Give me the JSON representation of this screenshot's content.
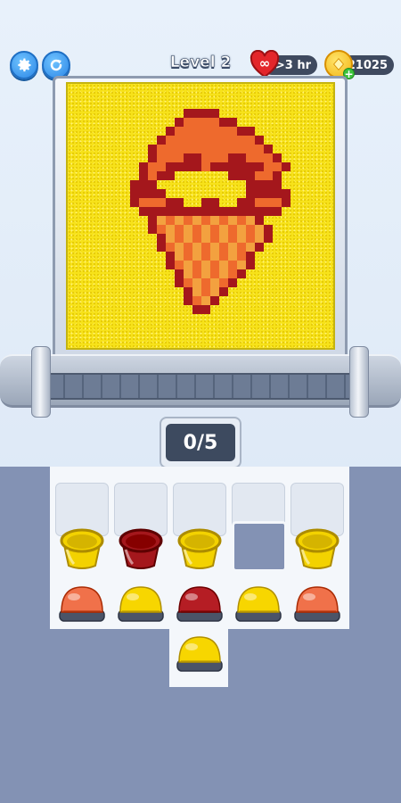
{
  "hud": {
    "level_label": "Level 2",
    "lives_text": "∞",
    "lives_timer": ">3 hr",
    "coins": "21025",
    "coin_plus": "+",
    "settings_icon": "gear-icon",
    "restart_icon": "restart-icon"
  },
  "progress": {
    "label": "0/5",
    "done": 0,
    "total": 5
  },
  "picture": {
    "subject": "ice-cream-cone",
    "colors": {
      "background": "#f7e21a",
      "orange": "#ee6a2d",
      "dark_red": "#a4171c",
      "light": "#f3a13f"
    }
  },
  "pieces": {
    "top_row": [
      {
        "kind": "cup",
        "color": "#f3d200"
      },
      {
        "kind": "cup",
        "color": "#a4171c"
      },
      {
        "kind": "cup",
        "color": "#f3d200"
      },
      {
        "kind": "empty",
        "color": ""
      },
      {
        "kind": "cup",
        "color": "#f3d200"
      }
    ],
    "bottom_row": [
      {
        "kind": "dome",
        "color": "#f0714a"
      },
      {
        "kind": "dome",
        "color": "#f7d600"
      },
      {
        "kind": "dome",
        "color": "#b51d24"
      },
      {
        "kind": "dome",
        "color": "#f7d600"
      },
      {
        "kind": "dome",
        "color": "#f0714a"
      }
    ],
    "extra": [
      {
        "kind": "dome",
        "color": "#f7d600"
      }
    ]
  }
}
